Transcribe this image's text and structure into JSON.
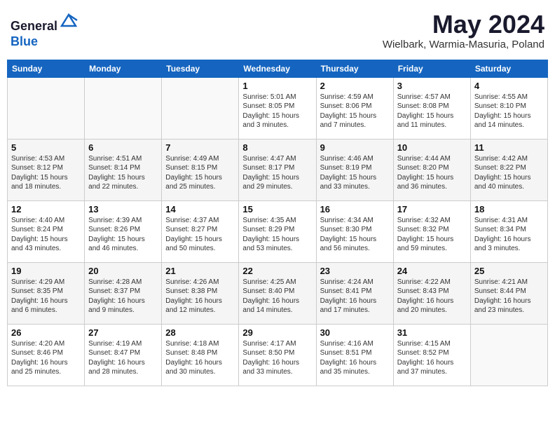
{
  "header": {
    "logo_line1": "General",
    "logo_line2": "Blue",
    "month_title": "May 2024",
    "location": "Wielbark, Warmia-Masuria, Poland"
  },
  "days_of_week": [
    "Sunday",
    "Monday",
    "Tuesday",
    "Wednesday",
    "Thursday",
    "Friday",
    "Saturday"
  ],
  "weeks": [
    [
      {
        "day": "",
        "info": ""
      },
      {
        "day": "",
        "info": ""
      },
      {
        "day": "",
        "info": ""
      },
      {
        "day": "1",
        "info": "Sunrise: 5:01 AM\nSunset: 8:05 PM\nDaylight: 15 hours and 3 minutes."
      },
      {
        "day": "2",
        "info": "Sunrise: 4:59 AM\nSunset: 8:06 PM\nDaylight: 15 hours and 7 minutes."
      },
      {
        "day": "3",
        "info": "Sunrise: 4:57 AM\nSunset: 8:08 PM\nDaylight: 15 hours and 11 minutes."
      },
      {
        "day": "4",
        "info": "Sunrise: 4:55 AM\nSunset: 8:10 PM\nDaylight: 15 hours and 14 minutes."
      }
    ],
    [
      {
        "day": "5",
        "info": "Sunrise: 4:53 AM\nSunset: 8:12 PM\nDaylight: 15 hours and 18 minutes."
      },
      {
        "day": "6",
        "info": "Sunrise: 4:51 AM\nSunset: 8:14 PM\nDaylight: 15 hours and 22 minutes."
      },
      {
        "day": "7",
        "info": "Sunrise: 4:49 AM\nSunset: 8:15 PM\nDaylight: 15 hours and 25 minutes."
      },
      {
        "day": "8",
        "info": "Sunrise: 4:47 AM\nSunset: 8:17 PM\nDaylight: 15 hours and 29 minutes."
      },
      {
        "day": "9",
        "info": "Sunrise: 4:46 AM\nSunset: 8:19 PM\nDaylight: 15 hours and 33 minutes."
      },
      {
        "day": "10",
        "info": "Sunrise: 4:44 AM\nSunset: 8:20 PM\nDaylight: 15 hours and 36 minutes."
      },
      {
        "day": "11",
        "info": "Sunrise: 4:42 AM\nSunset: 8:22 PM\nDaylight: 15 hours and 40 minutes."
      }
    ],
    [
      {
        "day": "12",
        "info": "Sunrise: 4:40 AM\nSunset: 8:24 PM\nDaylight: 15 hours and 43 minutes."
      },
      {
        "day": "13",
        "info": "Sunrise: 4:39 AM\nSunset: 8:26 PM\nDaylight: 15 hours and 46 minutes."
      },
      {
        "day": "14",
        "info": "Sunrise: 4:37 AM\nSunset: 8:27 PM\nDaylight: 15 hours and 50 minutes."
      },
      {
        "day": "15",
        "info": "Sunrise: 4:35 AM\nSunset: 8:29 PM\nDaylight: 15 hours and 53 minutes."
      },
      {
        "day": "16",
        "info": "Sunrise: 4:34 AM\nSunset: 8:30 PM\nDaylight: 15 hours and 56 minutes."
      },
      {
        "day": "17",
        "info": "Sunrise: 4:32 AM\nSunset: 8:32 PM\nDaylight: 15 hours and 59 minutes."
      },
      {
        "day": "18",
        "info": "Sunrise: 4:31 AM\nSunset: 8:34 PM\nDaylight: 16 hours and 3 minutes."
      }
    ],
    [
      {
        "day": "19",
        "info": "Sunrise: 4:29 AM\nSunset: 8:35 PM\nDaylight: 16 hours and 6 minutes."
      },
      {
        "day": "20",
        "info": "Sunrise: 4:28 AM\nSunset: 8:37 PM\nDaylight: 16 hours and 9 minutes."
      },
      {
        "day": "21",
        "info": "Sunrise: 4:26 AM\nSunset: 8:38 PM\nDaylight: 16 hours and 12 minutes."
      },
      {
        "day": "22",
        "info": "Sunrise: 4:25 AM\nSunset: 8:40 PM\nDaylight: 16 hours and 14 minutes."
      },
      {
        "day": "23",
        "info": "Sunrise: 4:24 AM\nSunset: 8:41 PM\nDaylight: 16 hours and 17 minutes."
      },
      {
        "day": "24",
        "info": "Sunrise: 4:22 AM\nSunset: 8:43 PM\nDaylight: 16 hours and 20 minutes."
      },
      {
        "day": "25",
        "info": "Sunrise: 4:21 AM\nSunset: 8:44 PM\nDaylight: 16 hours and 23 minutes."
      }
    ],
    [
      {
        "day": "26",
        "info": "Sunrise: 4:20 AM\nSunset: 8:46 PM\nDaylight: 16 hours and 25 minutes."
      },
      {
        "day": "27",
        "info": "Sunrise: 4:19 AM\nSunset: 8:47 PM\nDaylight: 16 hours and 28 minutes."
      },
      {
        "day": "28",
        "info": "Sunrise: 4:18 AM\nSunset: 8:48 PM\nDaylight: 16 hours and 30 minutes."
      },
      {
        "day": "29",
        "info": "Sunrise: 4:17 AM\nSunset: 8:50 PM\nDaylight: 16 hours and 33 minutes."
      },
      {
        "day": "30",
        "info": "Sunrise: 4:16 AM\nSunset: 8:51 PM\nDaylight: 16 hours and 35 minutes."
      },
      {
        "day": "31",
        "info": "Sunrise: 4:15 AM\nSunset: 8:52 PM\nDaylight: 16 hours and 37 minutes."
      },
      {
        "day": "",
        "info": ""
      }
    ]
  ]
}
